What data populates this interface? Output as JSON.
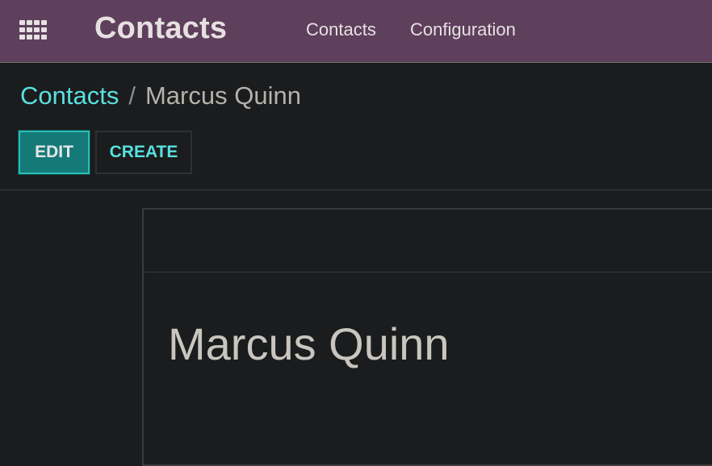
{
  "topbar": {
    "apps_icon": "grid-apps-icon",
    "app_title": "Contacts",
    "menu": {
      "contacts": "Contacts",
      "configuration": "Configuration"
    },
    "bg_color": "#5e3f5c"
  },
  "breadcrumb": {
    "parent": "Contacts",
    "separator": "/",
    "current": "Marcus Quinn"
  },
  "buttons": {
    "edit": "EDIT",
    "create": "CREATE"
  },
  "form": {
    "name": "Marcus Quinn"
  },
  "colors": {
    "accent": "#59e0e0",
    "primary_button": "#147a77",
    "background": "#1b1c1d"
  }
}
